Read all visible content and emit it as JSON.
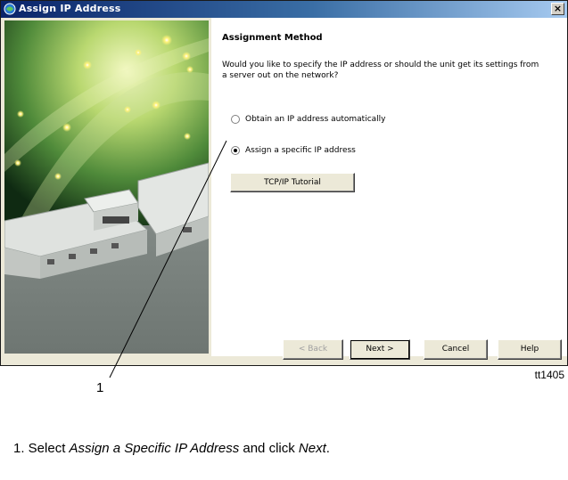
{
  "window": {
    "title": "Assign IP Address",
    "close_label": "×"
  },
  "page": {
    "heading": "Assignment Method",
    "question": "Would you like to specify the IP address or should the unit get its settings from a server out on the network?",
    "radio_options": [
      {
        "label": "Obtain an IP address automatically",
        "checked": false
      },
      {
        "label": "Assign a specific IP address",
        "checked": true
      }
    ],
    "tutorial_button": "TCP/IP Tutorial"
  },
  "buttons": {
    "back": "< Back",
    "next": "Next >",
    "cancel": "Cancel",
    "help": "Help"
  },
  "annotation": {
    "callout_number": "1",
    "figure_id": "tt1405",
    "caption_prefix": "1. Select ",
    "caption_emph1": "Assign a Specific IP Address",
    "caption_mid": " and click ",
    "caption_emph2": "Next",
    "caption_end": "."
  },
  "colors": {
    "titlebar_start": "#0a246a",
    "dialog_bg": "#ece9d8",
    "content_bg": "#ffffff"
  }
}
